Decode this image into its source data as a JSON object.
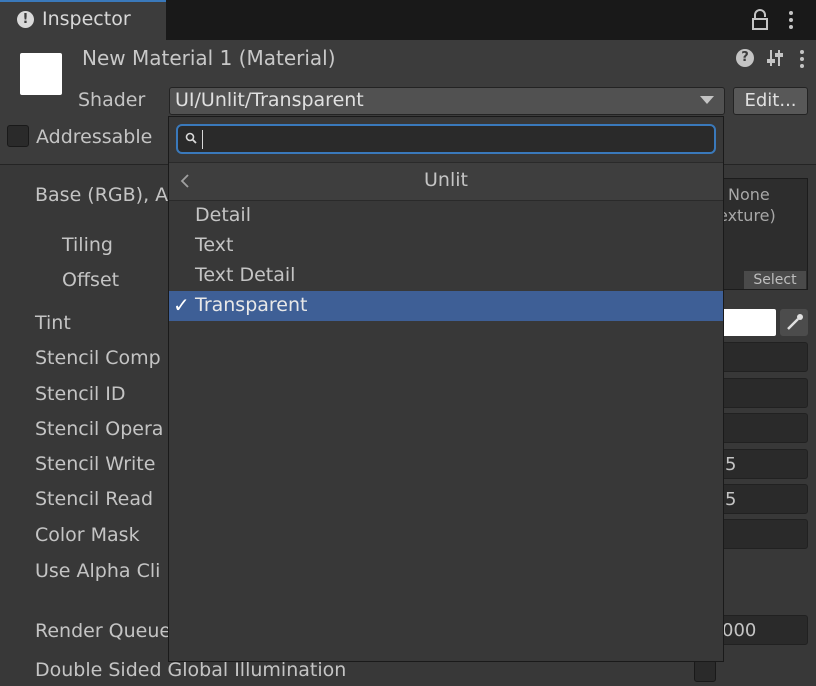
{
  "window": {
    "tab_label": "Inspector"
  },
  "material": {
    "title": "New Material 1 (Material)",
    "swatch_color": "#ffffff",
    "shader_label": "Shader",
    "shader_value": "UI/Unlit/Transparent",
    "edit_label": "Edit...",
    "addressable_label": "Addressable",
    "addressable_checked": false
  },
  "properties": {
    "base": "Base (RGB), A",
    "tiling": "Tiling",
    "offset": "Offset",
    "tint": "Tint",
    "stencil_comp": "Stencil Comp",
    "stencil_id": "Stencil ID",
    "stencil_operation": "Stencil Opera",
    "stencil_write": "Stencil Write",
    "stencil_read": "Stencil Read",
    "color_mask": "Color Mask",
    "use_alpha_clip": "Use Alpha Cli",
    "render_queue": "Render Queue",
    "double_sided_gi": "Double Sided Global Illumination",
    "texture_none": "None",
    "texture_type": "exture)",
    "texture_select": "Select",
    "tint_color": "#ffffff",
    "stencil_write_value": "5",
    "stencil_read_value": "5",
    "render_queue_value": "000"
  },
  "dropdown": {
    "search_placeholder": "",
    "title": "Unlit",
    "items": [
      {
        "label": "Detail",
        "checked": false
      },
      {
        "label": "Text",
        "checked": false
      },
      {
        "label": "Text Detail",
        "checked": false
      },
      {
        "label": "Transparent",
        "checked": true
      }
    ],
    "check_glyph": "✓",
    "selected_color": "#3e5f96"
  },
  "colors": {
    "accent": "#3a79bb",
    "panel": "#383838",
    "header": "#3c3c3c"
  }
}
